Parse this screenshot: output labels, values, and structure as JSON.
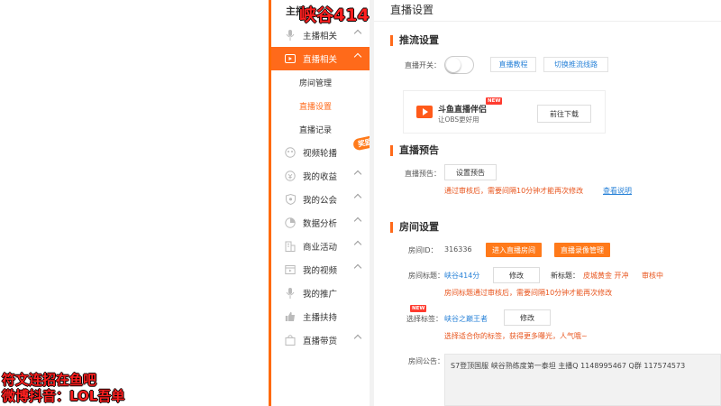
{
  "overlay": {
    "top_text": "峡谷414",
    "line1": "符文连招在鱼吧",
    "line2": "微博抖音：LOL吾单"
  },
  "sidebar": {
    "header": "主播",
    "items": [
      {
        "label": "主播相关",
        "icon": "microphone-icon"
      },
      {
        "label": "直播相关",
        "icon": "live-camera-icon",
        "active": true
      },
      {
        "label": "视频轮播",
        "icon": "video-carousel-icon",
        "badge": "奖励"
      },
      {
        "label": "我的收益",
        "icon": "coin-icon"
      },
      {
        "label": "我的公会",
        "icon": "shield-icon"
      },
      {
        "label": "数据分析",
        "icon": "pie-chart-icon"
      },
      {
        "label": "商业活动",
        "icon": "building-icon"
      },
      {
        "label": "我的视频",
        "icon": "film-icon"
      },
      {
        "label": "我的推广",
        "icon": "microphone-icon"
      },
      {
        "label": "主播扶持",
        "icon": "thumbs-up-icon"
      },
      {
        "label": "直播带货",
        "icon": "shopping-bag-icon"
      }
    ],
    "sub_items": [
      "房间管理",
      "直播设置",
      "直播记录"
    ]
  },
  "content": {
    "page_title": "直播设置",
    "push": {
      "section_title": "推流设置",
      "switch_label": "直播开关：",
      "tutorial_link": "直播教程",
      "switch_line_link": "切换推流线路",
      "promo_title": "斗鱼直播伴侣",
      "promo_new": "NEW",
      "promo_sub": "让OBS更好用",
      "promo_button": "前往下载"
    },
    "preview": {
      "section_title": "直播预告",
      "label": "直播预告：",
      "button": "设置预告",
      "warning": "通过审核后，需要间隔10分钟才能再次修改",
      "help_link": "查看说明"
    },
    "room": {
      "section_title": "房间设置",
      "id_label": "房间ID：",
      "id_value": "316336",
      "enter_room": "进入直播房间",
      "record_manage": "直播录像管理",
      "title_label": "房间标题：",
      "title_value": "峡谷414分",
      "modify": "修改",
      "new_title_label": "新标题：",
      "new_title_value": "皮城黄金 开冲",
      "review_status": "审核中",
      "title_warning": "房间标题通过审核后，需要间隔10分钟才能再次修改",
      "tag_new": "NEW",
      "tag_label": "选择标签：",
      "tag_value": "峡谷之巅王者",
      "tag_modify": "修改",
      "tag_hint": "选择适合你的标签，获得更多曝光，人气哦~",
      "notice_label": "房间公告：",
      "notice_text": "S7登顶国服 峡谷熟练度第一泰坦 主播Q 1148995467 Q群 117574573"
    }
  }
}
